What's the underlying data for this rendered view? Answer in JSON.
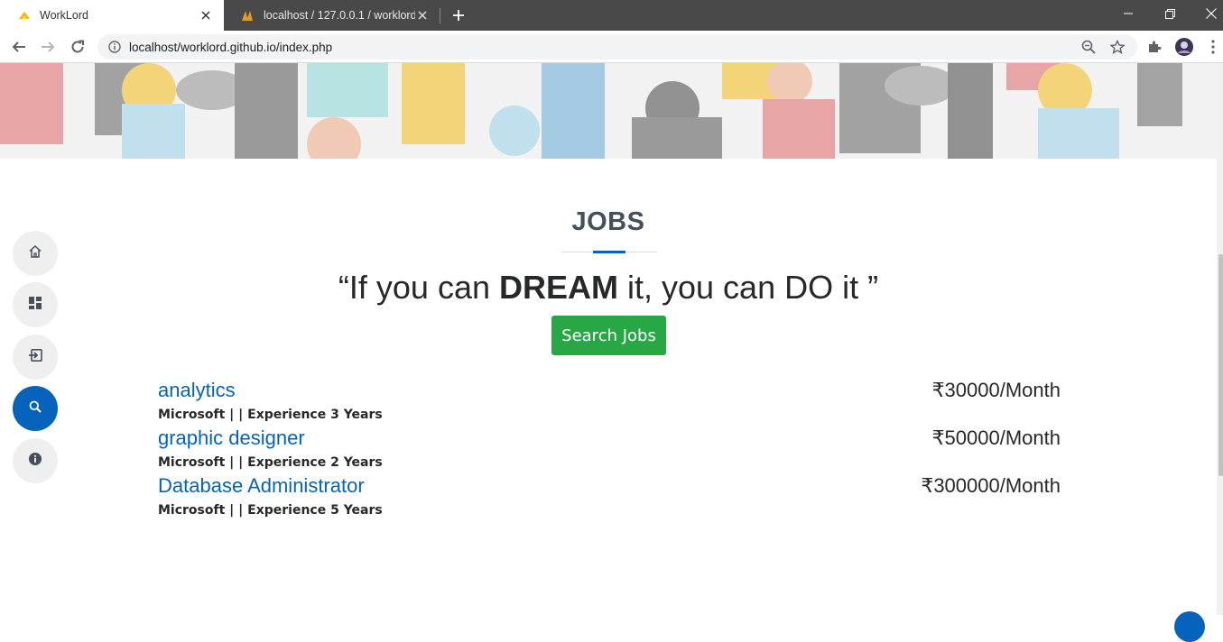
{
  "browser": {
    "tabs": [
      {
        "title": "WorkLord",
        "active": true
      },
      {
        "title": "localhost / 127.0.0.1 / worklord / ",
        "active": false
      }
    ],
    "url": "localhost/worklord.github.io/index.php"
  },
  "colors": {
    "accent": "#0563bb",
    "search_button": "#28a745",
    "heading": "#45505b",
    "text": "#272829"
  },
  "sidenav": {
    "items": [
      {
        "name": "home",
        "icon": "home-icon"
      },
      {
        "name": "dashboard",
        "icon": "dashboard-icon"
      },
      {
        "name": "login",
        "icon": "login-icon"
      },
      {
        "name": "search",
        "icon": "search-icon",
        "active": true
      },
      {
        "name": "info",
        "icon": "info-icon"
      }
    ]
  },
  "jobs_section": {
    "title": "JOBS",
    "quote_start": "“If you can ",
    "quote_bold": "DREAM",
    "quote_end": " it, you can DO it ”",
    "search_button": "Search Jobs",
    "listings": [
      {
        "title": "analytics",
        "salary": "₹30000/Month",
        "meta": "Microsoft | | Experience 3 Years"
      },
      {
        "title": "graphic designer",
        "salary": "₹50000/Month",
        "meta": "Microsoft | | Experience 2 Years"
      },
      {
        "title": "Database Administrator",
        "salary": "₹300000/Month",
        "meta": "Microsoft | | Experience 5 Years"
      }
    ]
  }
}
